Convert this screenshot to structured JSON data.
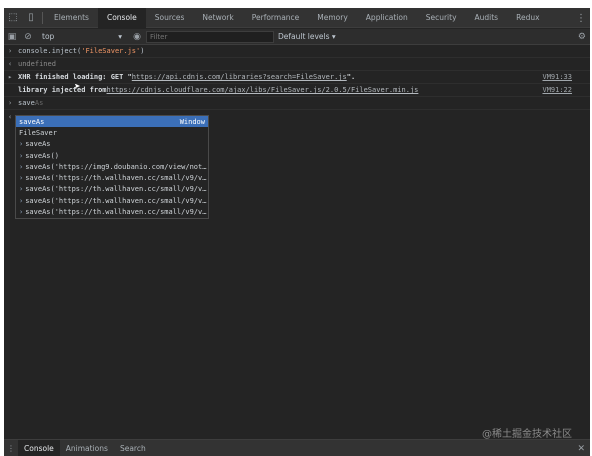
{
  "tabs": [
    {
      "label": "Elements"
    },
    {
      "label": "Console"
    },
    {
      "label": "Sources"
    },
    {
      "label": "Network"
    },
    {
      "label": "Performance"
    },
    {
      "label": "Memory"
    },
    {
      "label": "Application"
    },
    {
      "label": "Security"
    },
    {
      "label": "Audits"
    },
    {
      "label": "Redux"
    }
  ],
  "toolbar": {
    "context": "top",
    "filter_placeholder": "Filter",
    "levels": "Default levels ▾"
  },
  "console": {
    "cmd_prefix": "console.",
    "cmd_method": "inject",
    "cmd_arg": "'FileSaver.js'",
    "cmd_close": ")",
    "result": "undefined",
    "xhr_prefix": "XHR finished loading: GET \"",
    "xhr_url": "https://api.cdnjs.com/libraries?search=FileSaver.js",
    "xhr_suffix": "\".",
    "xhr_src": "VM91:33",
    "inject_prefix": "library injected from ",
    "inject_url": "https://cdnjs.cloudflare.com/ajax/libs/FileSaver.js/2.0.5/FileSaver.min.js",
    "inject_src": "VM91:22",
    "input_typed": "save",
    "input_hint": "As"
  },
  "autocomplete": {
    "selected": {
      "label": "saveAs",
      "type": "Window"
    },
    "items": [
      "FileSaver",
      "saveAs",
      "saveAs()",
      "saveAs('https://img9.doubanio.com/view/not…",
      "saveAs('https://th.wallhaven.cc/small/v9/v…",
      "saveAs('https://th.wallhaven.cc/small/v9/v…",
      "saveAs('https://th.wallhaven.cc/small/v9/v…",
      "saveAs('https://th.wallhaven.cc/small/v9/v…"
    ]
  },
  "drawer": {
    "tabs": [
      {
        "label": "Console"
      },
      {
        "label": "Animations"
      },
      {
        "label": "Search"
      }
    ]
  },
  "watermark": "@稀土掘金技术社区",
  "icons": {
    "inspect": "inspect-icon",
    "device": "device-toggle-icon",
    "more": "more-vertical-icon",
    "sidebar": "sidebar-toggle-icon",
    "clear": "clear-console-icon",
    "eye": "eye-icon",
    "gear": "gear-icon",
    "close": "close-icon"
  }
}
